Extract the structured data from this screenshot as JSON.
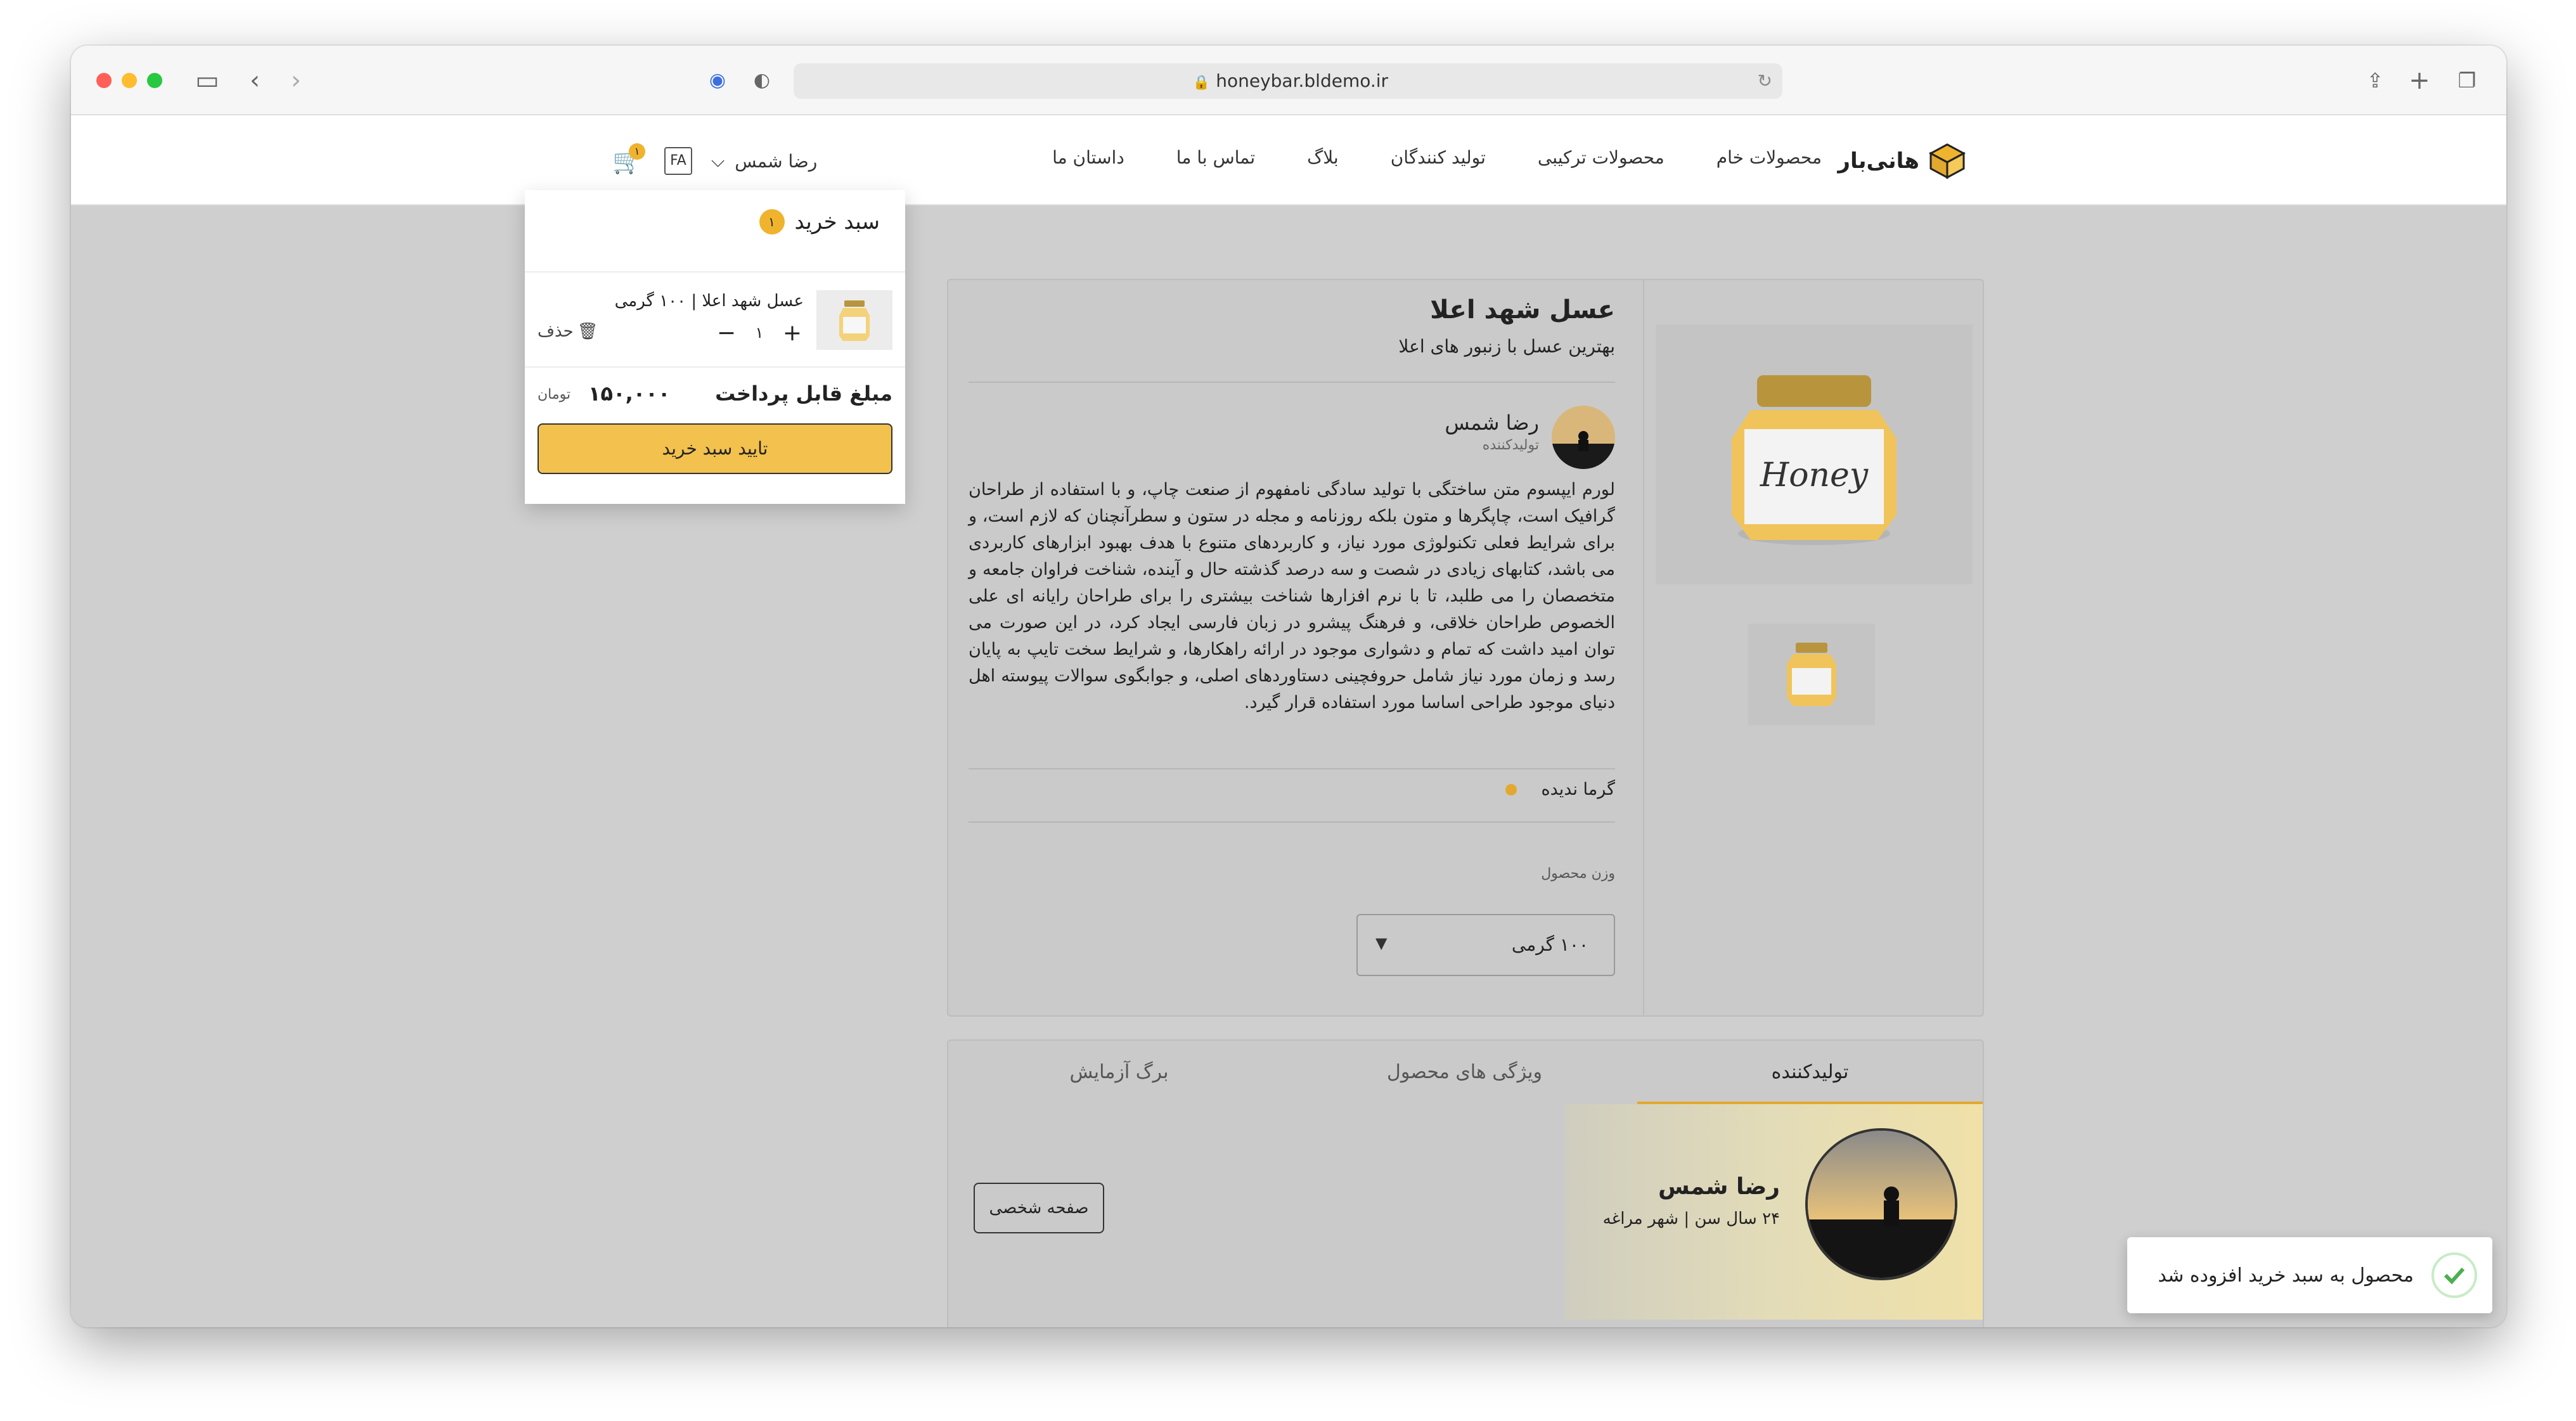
{
  "browser": {
    "url": "honeybar.bldemo.ir"
  },
  "header": {
    "logo_text": "هانی‌بار",
    "nav": [
      "محصولات خام",
      "محصولات ترکیبی",
      "تولید کنندگان",
      "بلاگ",
      "تماس با ما",
      "داستان ما"
    ],
    "user_name": "رضا شمس",
    "lang": "FA",
    "cart_count": "۱"
  },
  "cart": {
    "title": "سبد خرید",
    "count": "۱",
    "item_name": "عسل شهد اعلا | ۱۰۰ گرمی",
    "item_qty": "۱",
    "delete_label": "حذف",
    "total_label": "مبلغ قابل پرداخت",
    "total_value": "۱۵۰,۰۰۰",
    "currency": "تومان",
    "confirm_label": "تایید سبد خرید"
  },
  "product": {
    "title": "عسل شهد اعلا",
    "subtitle": "بهترین عسل با زنبور های اعلا",
    "producer_name": "رضا شمس",
    "producer_role": "تولیدکننده",
    "description": "لورم ایپسوم متن ساختگی با تولید سادگی نامفهوم از صنعت چاپ، و با استفاده از طراحان گرافیک است، چاپگرها و متون بلکه روزنامه و مجله در ستون و سطرآنچنان که لازم است، و برای شرایط فعلی تکنولوژی مورد نیاز، و کاربردهای متنوع با هدف بهبود ابزارهای کاربردی می باشد، کتابهای زیادی در شصت و سه درصد گذشته حال و آینده، شناخت فراوان جامعه و متخصصان را می طلبد، تا با نرم افزارها شناخت بیشتری را برای طراحان رایانه ای علی الخصوص طراحان خلاقی، و فرهنگ پیشرو در زبان فارسی ایجاد کرد، در این صورت می توان امید داشت که تمام و دشواری موجود در ارائه راهکارها، و شرایط سخت تایپ به پایان رسد و زمان مورد نیاز شامل حروفچینی دستاوردهای اصلی، و جوابگوی سوالات پیوسته اهل دنیای موجود طراحی اساسا مورد استفاده قرار گیرد.",
    "feature": "گرما ندیده",
    "weight_label": "وزن محصول",
    "weight_value": "۱۰۰ گرمی"
  },
  "tabs": {
    "producer": "تولیدکننده",
    "features": "ویژگی های محصول",
    "lab": "برگ آزمایش"
  },
  "producer_card": {
    "name": "رضا شمس",
    "info": "۲۴ سال سن | شهر مراغه",
    "profile_button": "صفحه شخصی"
  },
  "toast": {
    "message": "محصول به سبد خرید افزوده شد"
  },
  "colors": {
    "accent": "#f0b32e",
    "confirm": "#f2c14e",
    "success": "#4caf50"
  }
}
